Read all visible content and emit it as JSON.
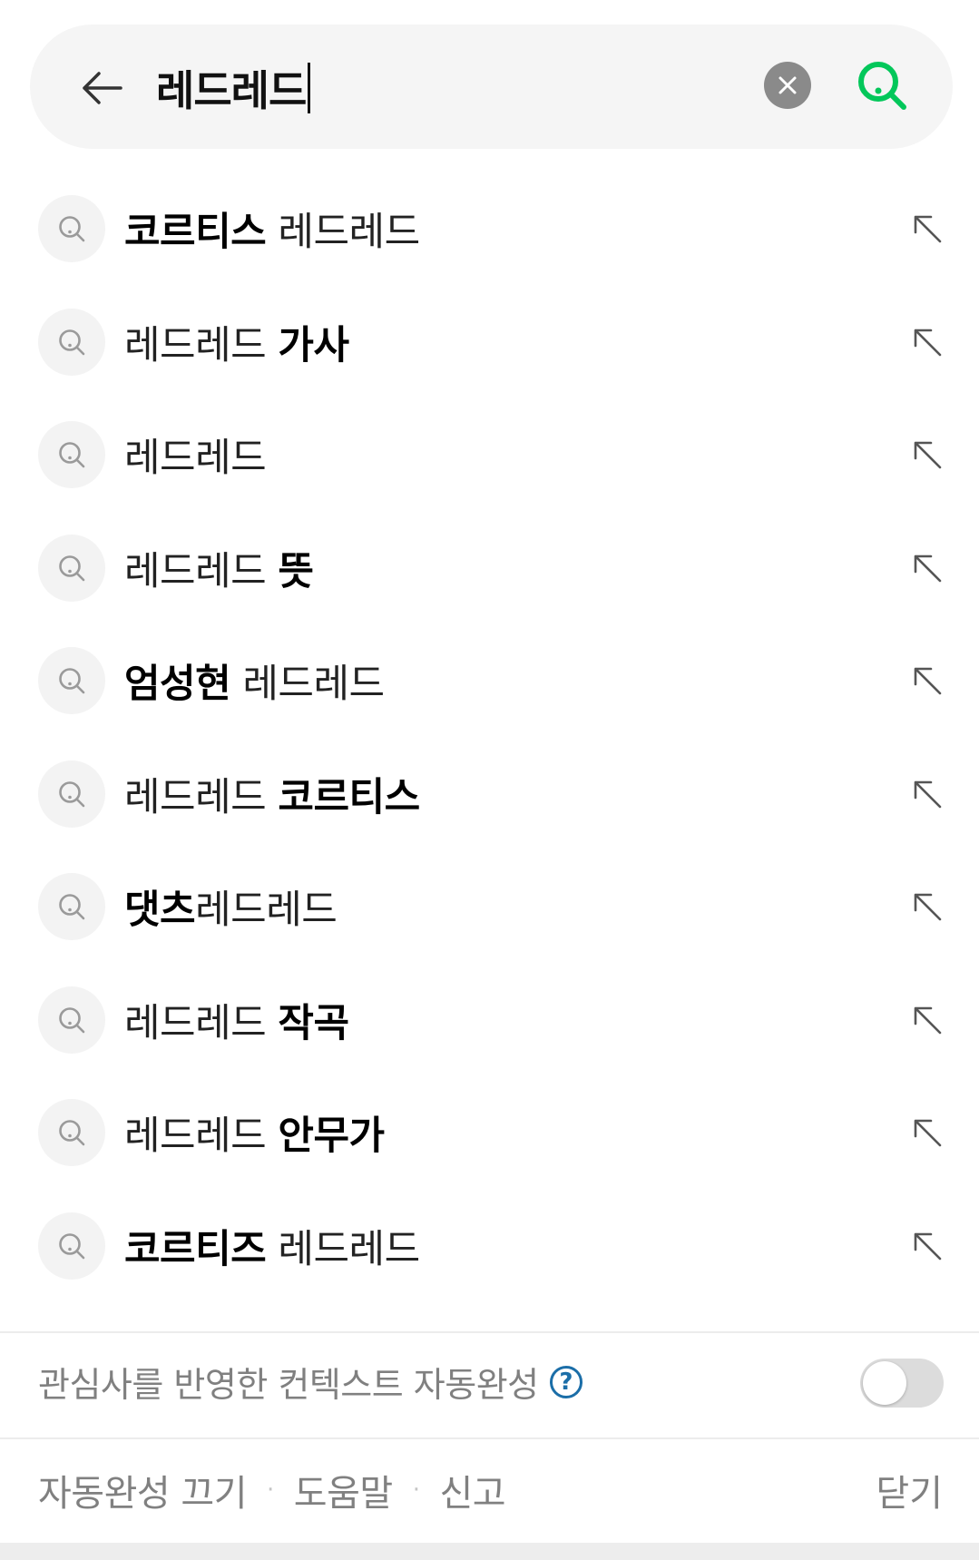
{
  "search": {
    "query": "레드레드"
  },
  "suggestions": [
    {
      "bold": "코르티스",
      "regular": " 레드레드",
      "order": "bold-first"
    },
    {
      "regular": "레드레드 ",
      "bold": "가사",
      "order": "regular-first"
    },
    {
      "regular": "레드레드",
      "bold": "",
      "order": "regular-first"
    },
    {
      "regular": "레드레드 ",
      "bold": "뜻",
      "order": "regular-first"
    },
    {
      "bold": "엄성현",
      "regular": " 레드레드",
      "order": "bold-first"
    },
    {
      "regular": "레드레드 ",
      "bold": "코르티스",
      "order": "regular-first"
    },
    {
      "bold": "댓츠",
      "regular": "레드레드",
      "order": "bold-first"
    },
    {
      "regular": "레드레드 ",
      "bold": "작곡",
      "order": "regular-first"
    },
    {
      "regular": "레드레드 ",
      "bold": "안무가",
      "order": "regular-first"
    },
    {
      "bold": "코르티즈",
      "regular": " 레드레드",
      "order": "bold-first"
    }
  ],
  "context_autocomplete": {
    "label": "관심사를 반영한 컨텍스트 자동완성",
    "help_glyph": "?",
    "enabled": false
  },
  "footer": {
    "turn_off": "자동완성 끄기",
    "help": "도움말",
    "report": "신고",
    "separator": "·",
    "close": "닫기"
  },
  "colors": {
    "accent_green": "#03c75a",
    "help_blue": "#1b6ea8",
    "muted_text": "#808080"
  },
  "icons": {
    "back": "arrow-left-icon",
    "clear": "close-circle-icon",
    "search": "search-icon",
    "suggestion": "search-icon",
    "fill_query": "arrow-up-left-icon"
  }
}
